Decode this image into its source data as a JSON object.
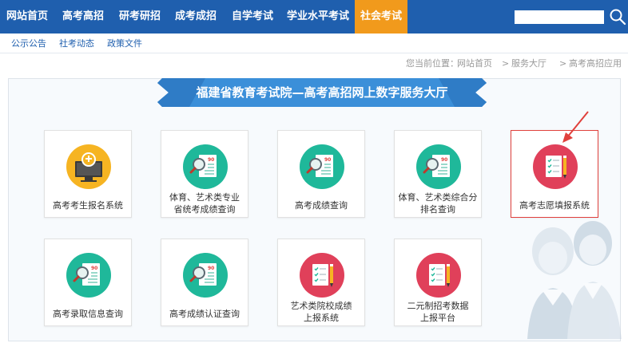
{
  "nav": {
    "items": [
      "网站首页",
      "高考高招",
      "研考研招",
      "成考成招",
      "自学考试",
      "学业水平考试",
      "社会考试"
    ],
    "active": "社会考试",
    "active_color": "#f19a1c",
    "bg_color": "#1f5fae"
  },
  "search": {
    "value": "",
    "placeholder": "",
    "icon": "search-icon"
  },
  "subnav": {
    "items": [
      "公示公告",
      "社考动态",
      "政策文件"
    ]
  },
  "breadcrumb": {
    "prefix": "您当前位置：",
    "items": [
      "网站首页",
      "服务大厅",
      "高考高招应用"
    ],
    "separator": ">"
  },
  "banner": {
    "title": "福建省教育考试院—高考高招网上数字服务大厅"
  },
  "services": [
    {
      "label": "高考考生报名系统",
      "icon": "computer-signup-icon",
      "color": "#f6b422"
    },
    {
      "label": "体育、艺术类专业\n省统考成绩查询",
      "icon": "report-search-icon",
      "color": "#1fb89a"
    },
    {
      "label": "高考成绩查询",
      "icon": "report-search-icon",
      "color": "#1fb89a"
    },
    {
      "label": "体育、艺术类综合分\n排名查询",
      "icon": "report-search-icon",
      "color": "#1fb89a"
    },
    {
      "label": "高考志愿填报系统",
      "icon": "checklist-pen-icon",
      "color": "#e0405a"
    },
    {
      "label": "高考录取信息查询",
      "icon": "report-search-icon",
      "color": "#1fb89a"
    },
    {
      "label": "高考成绩认证查询",
      "icon": "report-search-icon",
      "color": "#1fb89a"
    },
    {
      "label": "艺术类院校成绩\n上报系统",
      "icon": "checklist-pen-icon",
      "color": "#e0405a"
    },
    {
      "label": "二元制招考数据\n上报平台",
      "icon": "checklist-pen-icon",
      "color": "#e0405a"
    }
  ],
  "highlight_color": "#e0403c"
}
